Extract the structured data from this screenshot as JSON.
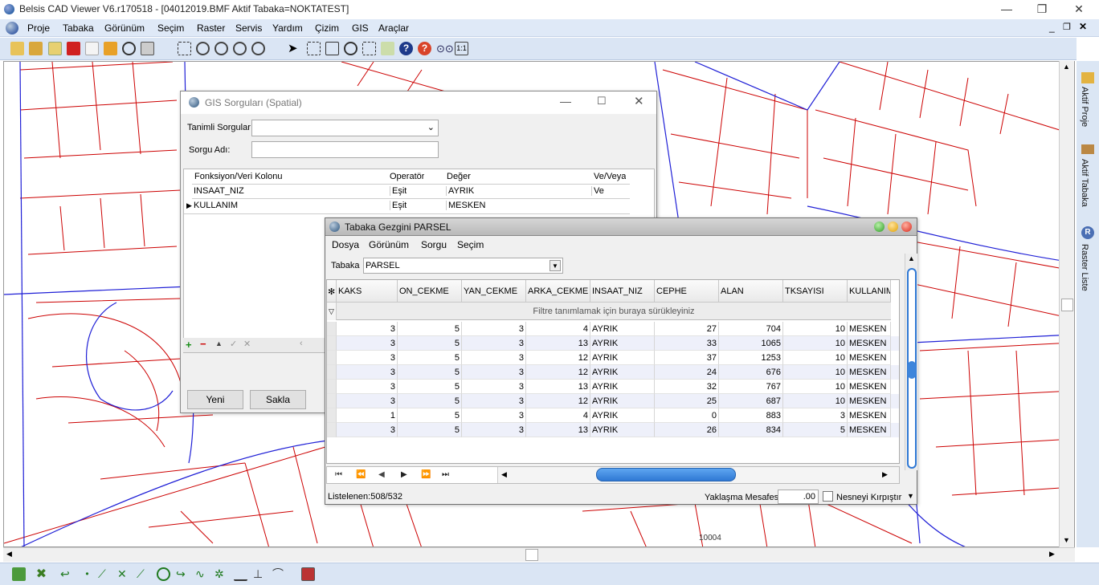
{
  "window": {
    "title": "Belsis CAD Viewer V6.r170518 - [04012019.BMF  Aktif Tabaka=NOKTATEST]"
  },
  "menu": [
    "Proje",
    "Tabaka",
    "Görünüm",
    "Seçim",
    "Raster",
    "Servis",
    "Yardım",
    "Çizim",
    "GIS",
    "Araçlar"
  ],
  "right_panel": {
    "tabs": [
      "Aktif Proje",
      "Aktif Tabaka",
      "Raster Liste"
    ]
  },
  "map": {
    "label": "10004"
  },
  "gis_dialog": {
    "title": "GIS Sorguları (Spatial)",
    "tanimli_label": "Tanimli Sorgular",
    "tanimli_value": "",
    "sorgu_adi_label": "Sorgu Adı:",
    "sorgu_adi_value": "",
    "columns": [
      "Fonksiyon/Veri Kolonu",
      "Operatör",
      "Değer",
      "Ve/Veya"
    ],
    "rows": [
      [
        "INSAAT_NIZ",
        "Eşit",
        "AYRIK",
        "Ve"
      ],
      [
        "KULLANIM",
        "Eşit",
        "MESKEN",
        ""
      ]
    ],
    "buttons": {
      "yeni": "Yeni",
      "sakla": "Sakla"
    }
  },
  "layer_browser": {
    "title": "Tabaka Gezgini PARSEL",
    "menu": [
      "Dosya",
      "Görünüm",
      "Sorgu",
      "Seçim"
    ],
    "tabaka_label": "Tabaka",
    "tabaka_value": "PARSEL",
    "columns": [
      "KAKS",
      "ON_CEKME",
      "YAN_CEKME",
      "ARKA_CEKME",
      "INSAAT_NIZ",
      "CEPHE",
      "ALAN",
      "TKSAYISI",
      "KULLANIM"
    ],
    "filter_hint": "Filtre tanımlamak için buraya sürükleyiniz",
    "rows": [
      [
        "3",
        "5",
        "3",
        "4",
        "AYRIK",
        "27",
        "704",
        "10",
        "MESKEN"
      ],
      [
        "3",
        "5",
        "3",
        "13",
        "AYRIK",
        "33",
        "1065",
        "10",
        "MESKEN"
      ],
      [
        "3",
        "5",
        "3",
        "12",
        "AYRIK",
        "37",
        "1253",
        "10",
        "MESKEN"
      ],
      [
        "3",
        "5",
        "3",
        "12",
        "AYRIK",
        "24",
        "676",
        "10",
        "MESKEN"
      ],
      [
        "3",
        "5",
        "3",
        "13",
        "AYRIK",
        "32",
        "767",
        "10",
        "MESKEN"
      ],
      [
        "3",
        "5",
        "3",
        "12",
        "AYRIK",
        "25",
        "687",
        "10",
        "MESKEN"
      ],
      [
        "1",
        "5",
        "3",
        "4",
        "AYRIK",
        "0",
        "883",
        "3",
        "MESKEN"
      ],
      [
        "3",
        "5",
        "3",
        "13",
        "AYRIK",
        "26",
        "834",
        "5",
        "MESKEN"
      ]
    ],
    "status_listed": "Listelenen:508/532",
    "approach_label": "Yaklaşma Mesafesi",
    "approach_value": ".00",
    "clip_label": "Nesneyi Kırpıştır"
  },
  "colors": {
    "parcel_line": "#cc0000",
    "road_line": "#1f1fd6",
    "menubar": "#dfe9f7"
  }
}
